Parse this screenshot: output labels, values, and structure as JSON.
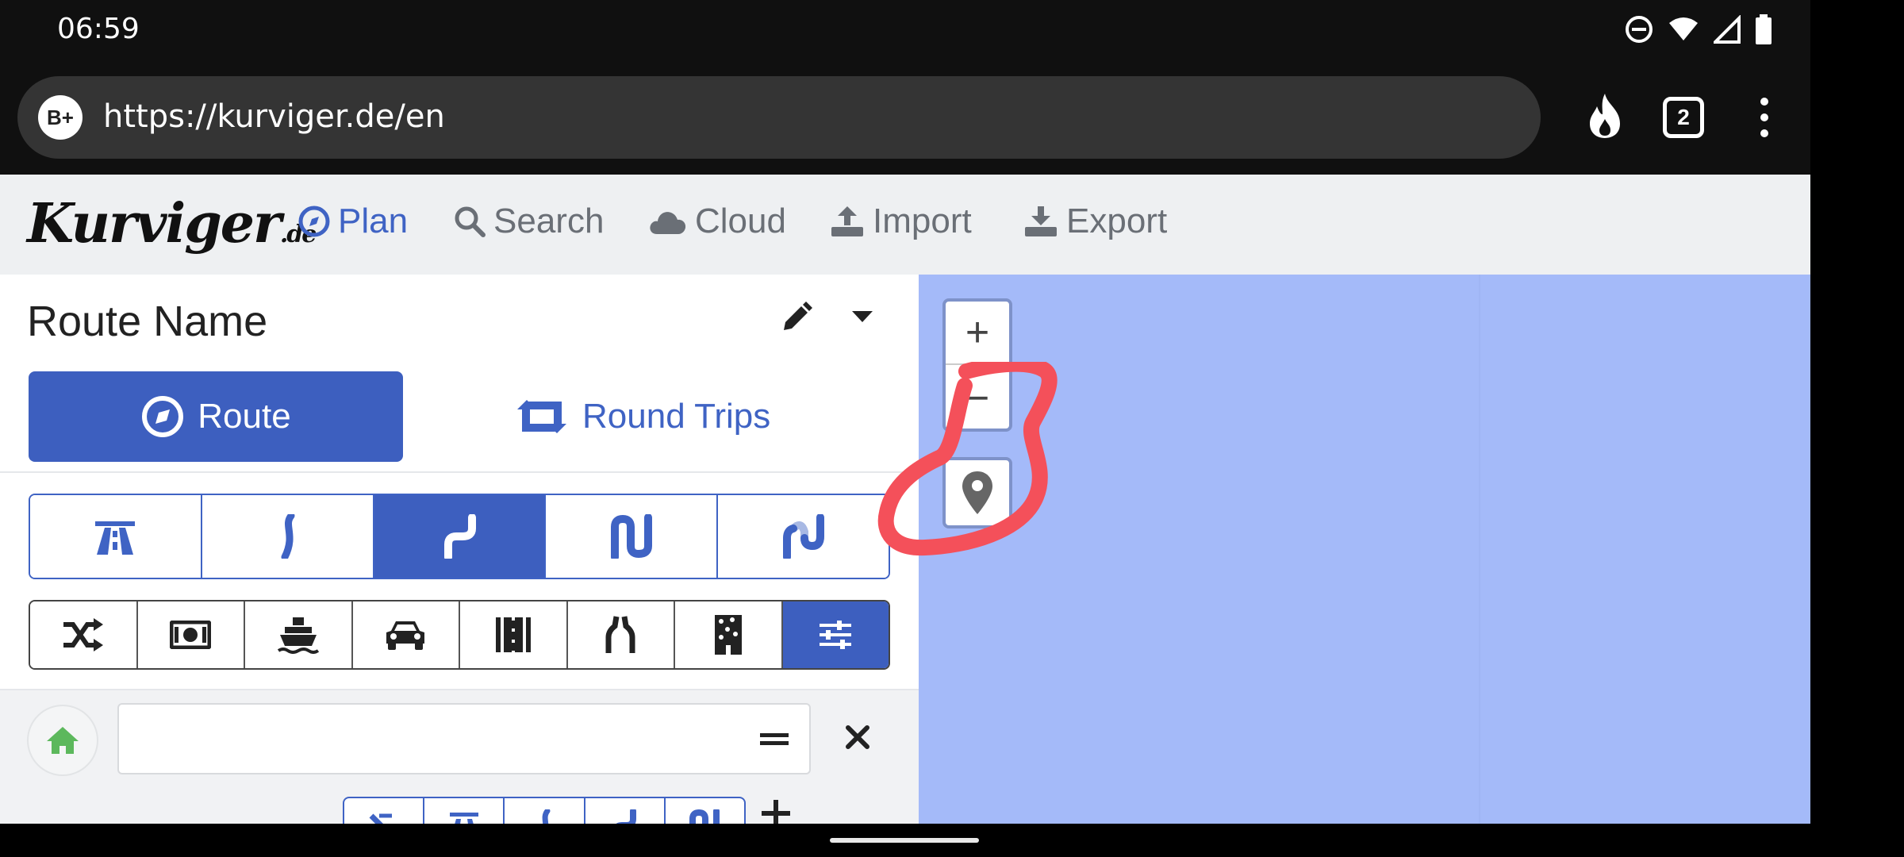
{
  "status_bar": {
    "time": "06:59",
    "icons": [
      "do-not-disturb-icon",
      "wifi-icon",
      "signal-icon",
      "battery-icon"
    ]
  },
  "browser": {
    "site_badge": "B+",
    "url": "https://kurviger.de/en",
    "tab_count": "2",
    "icons": [
      "fire-icon",
      "tabs-icon",
      "more-vert-icon"
    ]
  },
  "nav": {
    "logo_main": "Kurviger",
    "logo_suffix": ".de",
    "items": [
      {
        "label": "Plan",
        "icon": "compass-icon",
        "active": true
      },
      {
        "label": "Search",
        "icon": "search-icon"
      },
      {
        "label": "Cloud",
        "icon": "cloud-icon"
      },
      {
        "label": "Import",
        "icon": "upload-icon"
      },
      {
        "label": "Export",
        "icon": "download-icon"
      }
    ]
  },
  "panel": {
    "route_name": "Route Name",
    "route_button": "Route",
    "round_trips_button": "Round Trips",
    "curviness_options": [
      "highway-icon",
      "slight-curve-icon",
      "curvy-icon",
      "very-curvy-icon",
      "extreme-curvy-icon"
    ],
    "selected_curviness_index": 2,
    "avoid_options": [
      "shuffle-icon",
      "toll-icon",
      "ferry-icon",
      "car-icon",
      "road-icon",
      "narrow-road-icon",
      "unpaved-icon",
      "settings-sliders-icon"
    ],
    "waypoint": {
      "value": "",
      "placeholder": ""
    }
  },
  "map": {
    "background_color": "#a4baf9",
    "zoom_in": "+",
    "zoom_out": "−",
    "annotation_color": "#f4505a"
  },
  "colors": {
    "accent": "#3d5fbf",
    "home_green": "#5cb85c"
  }
}
